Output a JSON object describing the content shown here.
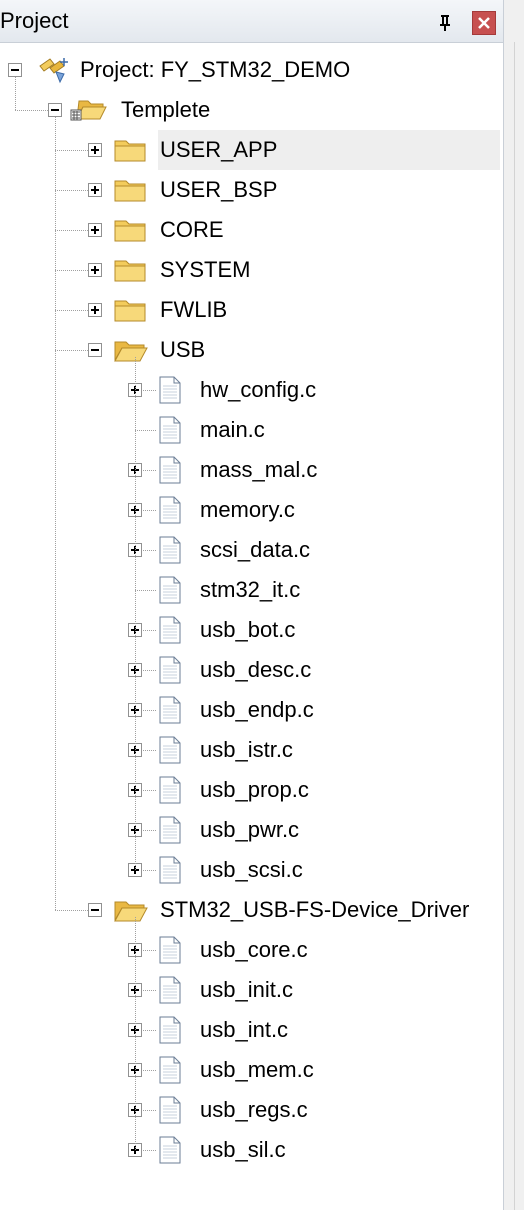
{
  "panel": {
    "title": "Project",
    "pin_icon": "pin-icon",
    "close_icon": "close-icon"
  },
  "tree": {
    "root": {
      "label": "Project: FY_STM32_DEMO",
      "icon": "project-icon",
      "expanded": true
    },
    "target": {
      "label": "Templete",
      "icon": "target-folder-icon",
      "expanded": true
    },
    "groups": [
      {
        "label": "USER_APP",
        "expanded": false,
        "selected": true
      },
      {
        "label": "USER_BSP",
        "expanded": false
      },
      {
        "label": "CORE",
        "expanded": false
      },
      {
        "label": "SYSTEM",
        "expanded": false
      },
      {
        "label": "FWLIB",
        "expanded": false
      },
      {
        "label": "USB",
        "expanded": true,
        "files": [
          {
            "label": "hw_config.c",
            "expandable": true
          },
          {
            "label": "main.c",
            "expandable": false
          },
          {
            "label": "mass_mal.c",
            "expandable": true
          },
          {
            "label": "memory.c",
            "expandable": true
          },
          {
            "label": "scsi_data.c",
            "expandable": true
          },
          {
            "label": "stm32_it.c",
            "expandable": false
          },
          {
            "label": "usb_bot.c",
            "expandable": true
          },
          {
            "label": "usb_desc.c",
            "expandable": true
          },
          {
            "label": "usb_endp.c",
            "expandable": true
          },
          {
            "label": "usb_istr.c",
            "expandable": true
          },
          {
            "label": "usb_prop.c",
            "expandable": true
          },
          {
            "label": "usb_pwr.c",
            "expandable": true
          },
          {
            "label": "usb_scsi.c",
            "expandable": true
          }
        ]
      },
      {
        "label": "STM32_USB-FS-Device_Driver",
        "expanded": true,
        "files": [
          {
            "label": "usb_core.c",
            "expandable": true
          },
          {
            "label": "usb_init.c",
            "expandable": true
          },
          {
            "label": "usb_int.c",
            "expandable": true
          },
          {
            "label": "usb_mem.c",
            "expandable": true
          },
          {
            "label": "usb_regs.c",
            "expandable": true
          },
          {
            "label": "usb_sil.c",
            "expandable": true
          }
        ]
      }
    ]
  },
  "colors": {
    "header_bg": "#e3e8ee",
    "close_bg": "#c75050",
    "selection_bg": "#eeeeee",
    "folder": "#f3cc5c"
  }
}
